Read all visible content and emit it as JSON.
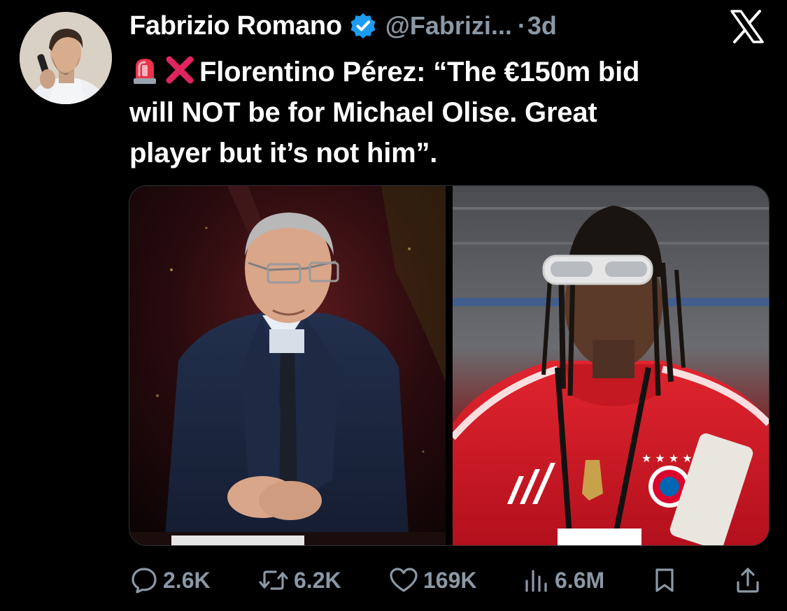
{
  "tweet": {
    "author_name": "Fabrizio Romano",
    "handle": "@Fabrizi...",
    "separator": "·",
    "time": "3d",
    "text_line1": "Florentino Pérez: “The €150m bid",
    "text_line2": "will NOT be for Michael Olise. Great",
    "text_line3": "player but it’s not him”.",
    "emojis": [
      "rotating-light-icon",
      "cross-mark-icon"
    ]
  },
  "actions": {
    "replies": "2.6K",
    "reposts": "6.2K",
    "likes": "169K",
    "views": "6.6M"
  },
  "colors": {
    "background": "#000000",
    "text": "#ffffff",
    "secondary": "#8b98a5",
    "verified": "#1d9bf0",
    "cross": "#e0245e"
  }
}
